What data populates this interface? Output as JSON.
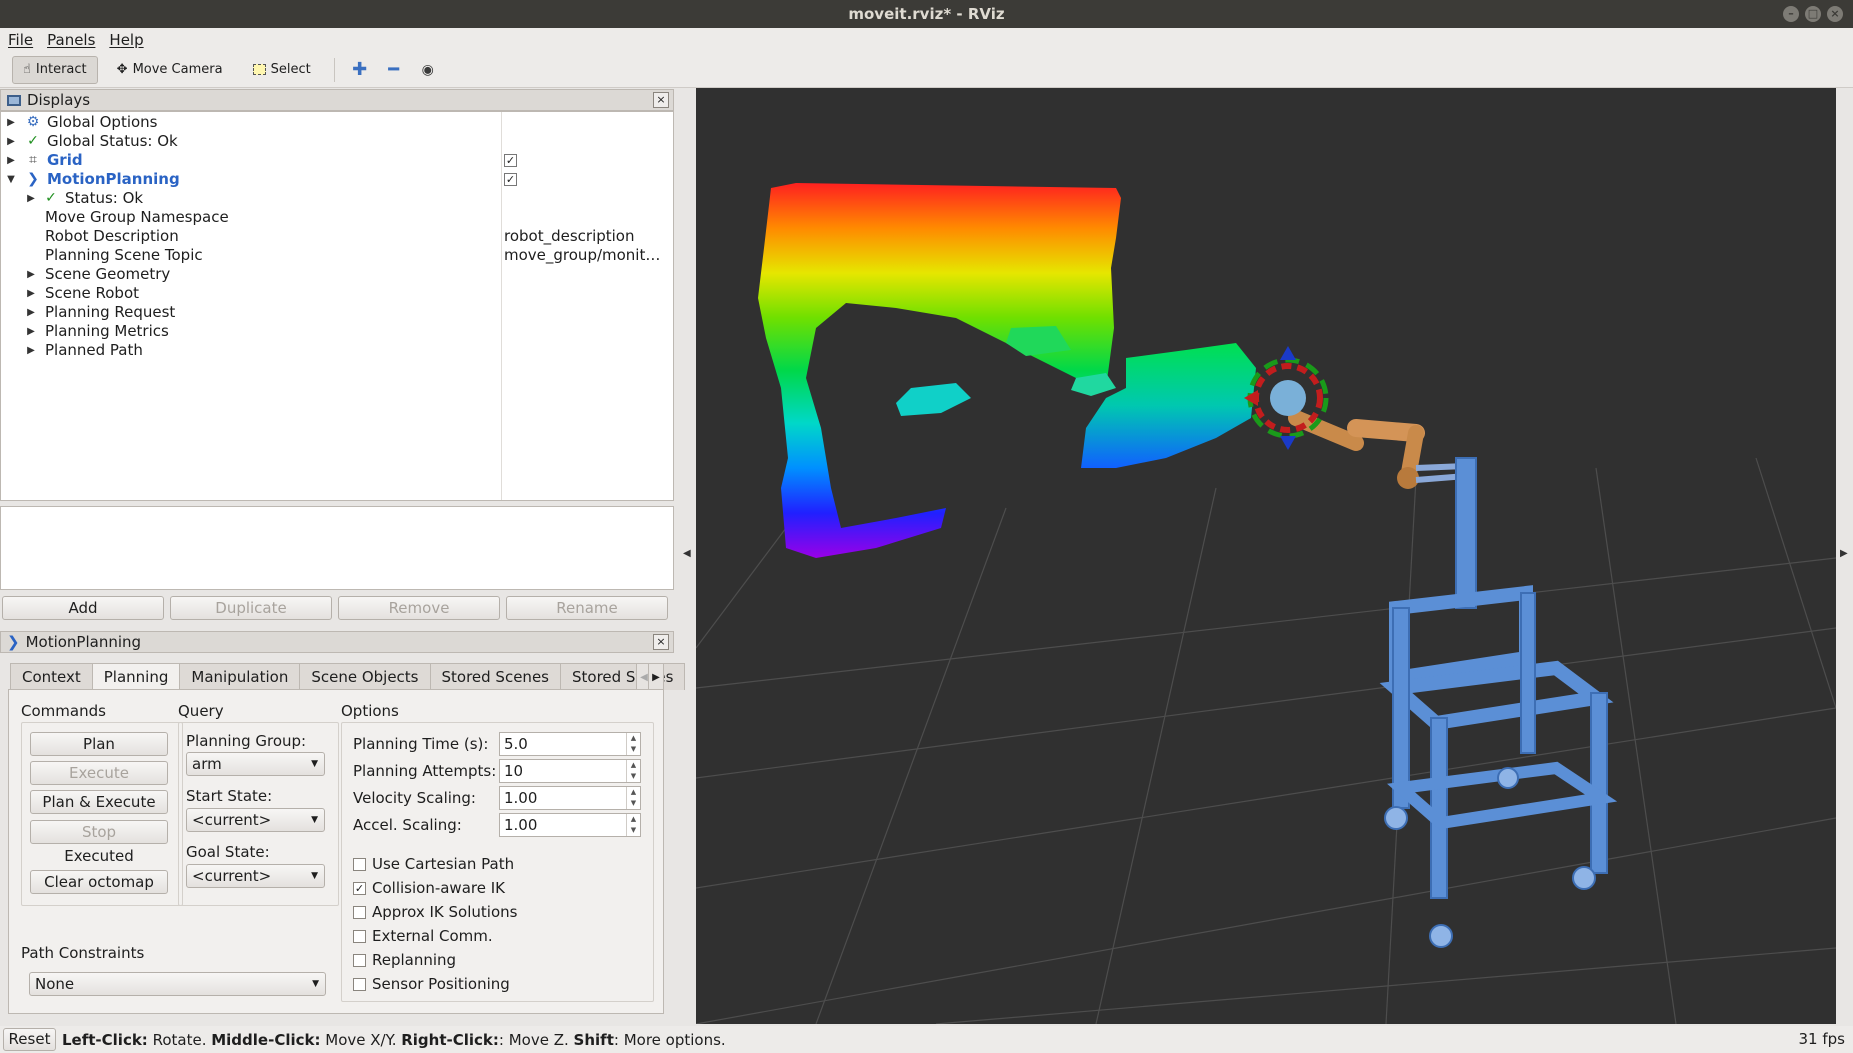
{
  "window": {
    "title": "moveit.rviz* - RViz"
  },
  "menu": [
    "File",
    "Panels",
    "Help"
  ],
  "toolbar": {
    "interact": "Interact",
    "move_camera": "Move Camera",
    "select": "Select"
  },
  "displays": {
    "title": "Displays",
    "rows": [
      {
        "label": "Global Options",
        "value": ""
      },
      {
        "label": "Global Status: Ok",
        "value": ""
      },
      {
        "label": "Grid",
        "value": ""
      },
      {
        "label": "MotionPlanning",
        "value": ""
      },
      {
        "label": "Status: Ok",
        "value": ""
      },
      {
        "label": "Move Group Namespace",
        "value": ""
      },
      {
        "label": "Robot Description",
        "value": "robot_description"
      },
      {
        "label": "Planning Scene Topic",
        "value": "move_group/monitor..."
      },
      {
        "label": "Scene Geometry",
        "value": ""
      },
      {
        "label": "Scene Robot",
        "value": ""
      },
      {
        "label": "Planning Request",
        "value": ""
      },
      {
        "label": "Planning Metrics",
        "value": ""
      },
      {
        "label": "Planned Path",
        "value": ""
      }
    ],
    "buttons": {
      "add": "Add",
      "duplicate": "Duplicate",
      "remove": "Remove",
      "rename": "Rename"
    }
  },
  "motion_planning": {
    "title": "MotionPlanning",
    "tabs": [
      "Context",
      "Planning",
      "Manipulation",
      "Scene Objects",
      "Stored Scenes",
      "Stored States"
    ],
    "active_tab": "Planning",
    "commands": {
      "title": "Commands",
      "plan": "Plan",
      "execute": "Execute",
      "plan_execute": "Plan & Execute",
      "stop": "Stop",
      "status": "Executed",
      "clear_octomap": "Clear octomap"
    },
    "query": {
      "title": "Query",
      "planning_group_label": "Planning Group:",
      "planning_group": "arm",
      "start_state_label": "Start State:",
      "start_state": "<current>",
      "goal_state_label": "Goal State:",
      "goal_state": "<current>"
    },
    "options": {
      "title": "Options",
      "planning_time_label": "Planning Time (s):",
      "planning_time": "5.0",
      "planning_attempts_label": "Planning Attempts:",
      "planning_attempts": "10",
      "velocity_scaling_label": "Velocity Scaling:",
      "velocity_scaling": "1.00",
      "accel_scaling_label": "Accel. Scaling:",
      "accel_scaling": "1.00",
      "checks": [
        {
          "label": "Use Cartesian Path",
          "checked": false
        },
        {
          "label": "Collision-aware IK",
          "checked": true
        },
        {
          "label": "Approx IK Solutions",
          "checked": false
        },
        {
          "label": "External Comm.",
          "checked": false
        },
        {
          "label": "Replanning",
          "checked": false
        },
        {
          "label": "Sensor Positioning",
          "checked": false
        }
      ]
    },
    "path_constraints": {
      "label": "Path Constraints",
      "value": "None"
    }
  },
  "status_bar": {
    "reset": "Reset",
    "left_click": "Left-Click:",
    "left_click_desc": " Rotate. ",
    "middle_click": "Middle-Click:",
    "middle_click_desc": " Move X/Y. ",
    "right_click": "Right-Click:",
    "right_click_desc": ": Move Z. ",
    "shift": "Shift",
    "shift_desc": ": More options.",
    "fps": "31 fps"
  },
  "colors": {
    "viewport_bg": "#303030",
    "grid_line": "#4a4a4a",
    "robot_cart": "#5b8fd6",
    "robot_arm": "#c98a4a",
    "link_blue": "#2a63c4"
  }
}
